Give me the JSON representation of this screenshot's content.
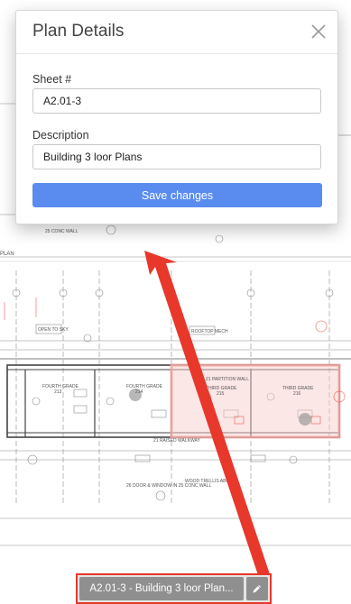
{
  "modal": {
    "title": "Plan Details",
    "sheet_label": "Sheet #",
    "sheet_value": "A2.01-3",
    "description_label": "Description",
    "description_value": "Building 3 loor Plans",
    "save_label": "Save changes"
  },
  "bottom_bar": {
    "sheet_text": "A2.01-3 - Building 3 loor Plan..."
  },
  "drawing": {
    "plan_label": "PLAN",
    "rooms": [
      {
        "name": "FOURTH GRADE",
        "number": "213"
      },
      {
        "name": "FOURTH GRADE",
        "number": "214"
      },
      {
        "name": "THIRD GRADE",
        "number": "215"
      },
      {
        "name": "THIRD GRADE",
        "number": "216"
      }
    ],
    "notes": {
      "wall": "25 CONC WALL",
      "partition": "21 PARTITION WALL",
      "walkway": "21 RAISED WALKWAY",
      "door": "26 DOOR & WINDOW IN 25 CONC WALL",
      "trellis": "WOOD TRELLIS ABOVE",
      "open_sky": "OPEN TO SKY",
      "rooftop": "ROOFTOP MECH"
    }
  },
  "colors": {
    "accent": "#5a8cf0",
    "arrow": "#e8372b",
    "highlight": "#f3b3b0"
  }
}
